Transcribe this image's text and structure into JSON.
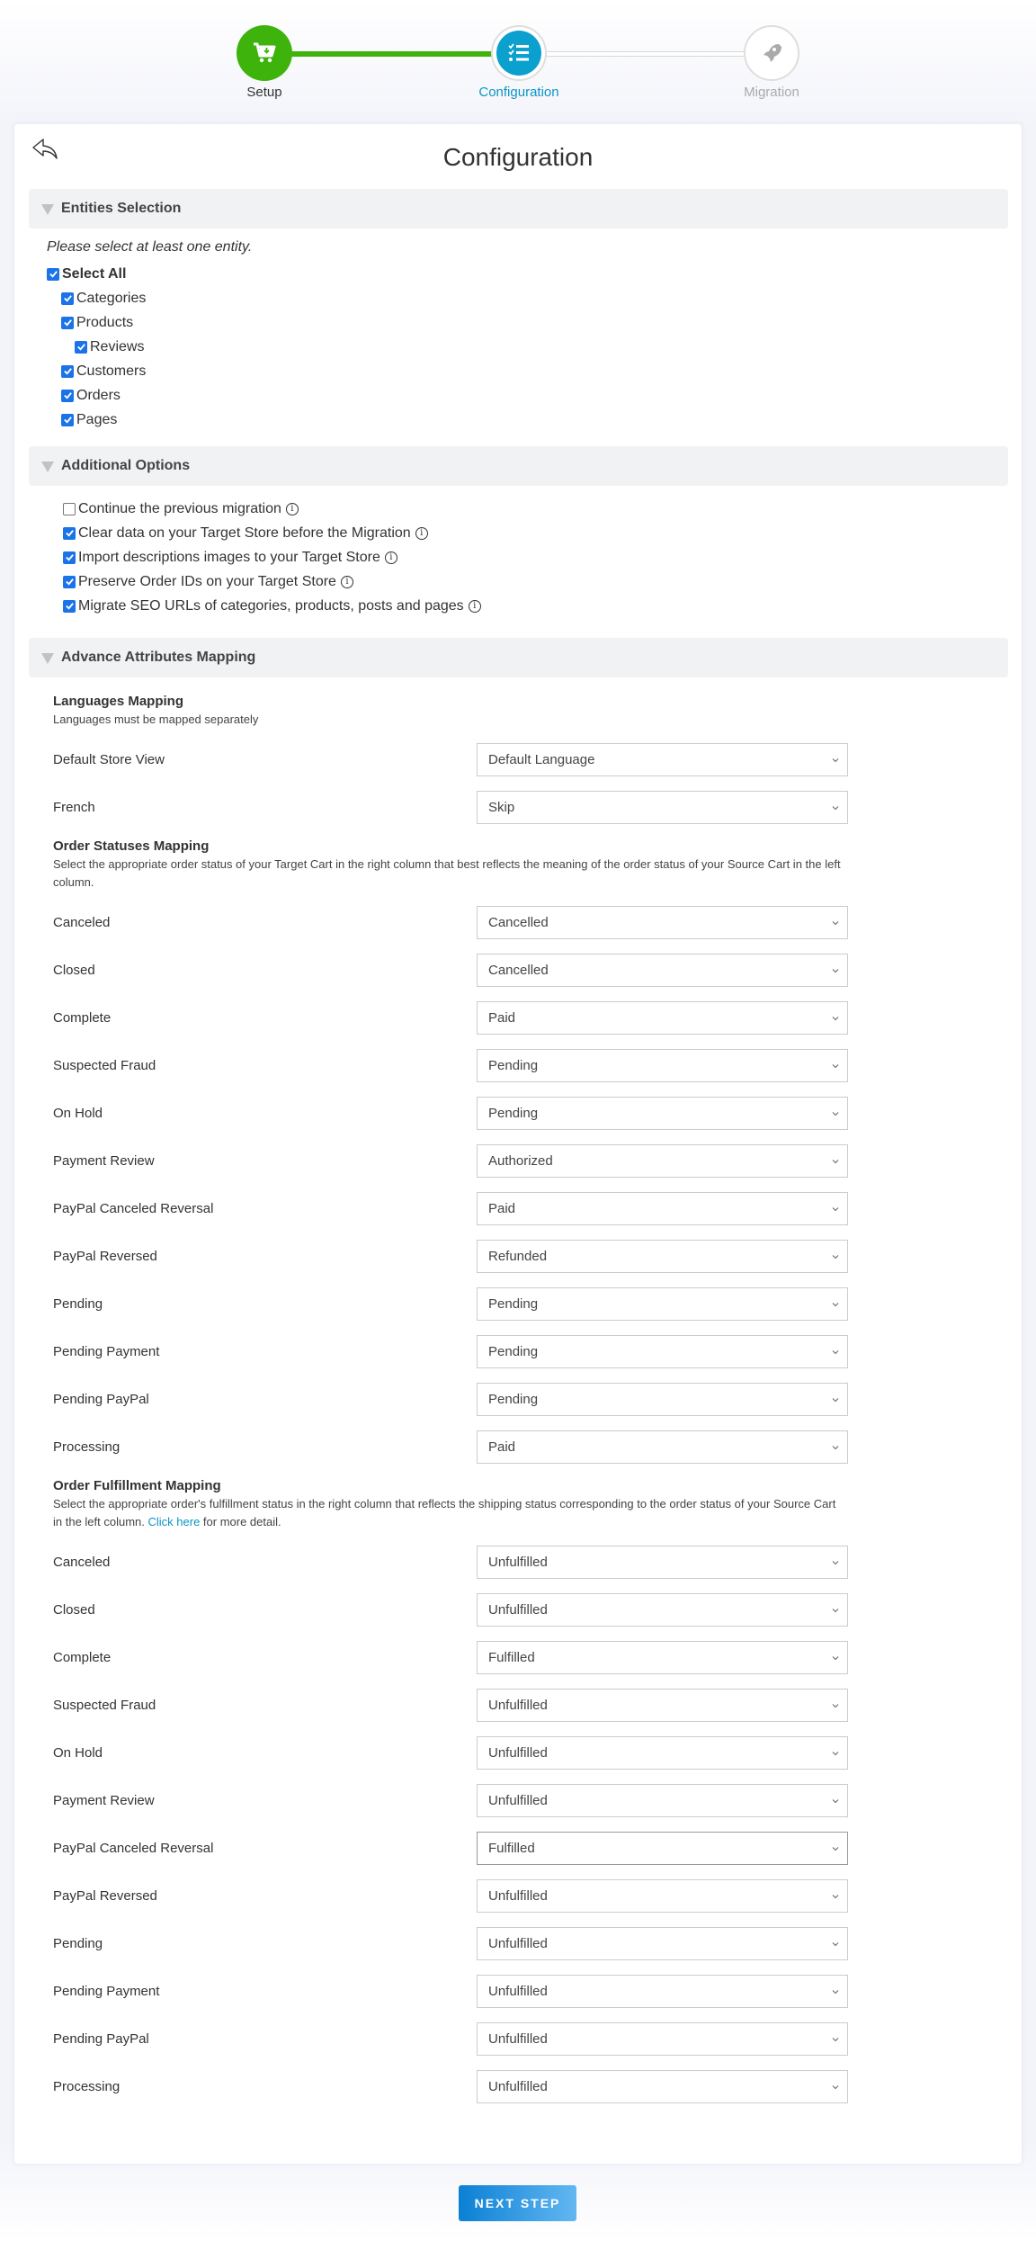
{
  "stepper": {
    "steps": [
      {
        "label": "Setup",
        "icon": "cart-download-icon",
        "state": "done"
      },
      {
        "label": "Configuration",
        "icon": "checklist-icon",
        "state": "active"
      },
      {
        "label": "Migration",
        "icon": "rocket-icon",
        "state": "pending"
      }
    ],
    "colors": {
      "done": "#3eb30b",
      "active": "#0ca0cf",
      "pending": "#aaaaaa"
    }
  },
  "card": {
    "title": "Configuration",
    "back_icon": "reply-arrow-icon"
  },
  "entities": {
    "header": "Entities Selection",
    "hint": "Please select at least one entity.",
    "select_all": {
      "label": "Select All",
      "checked": true
    },
    "items": [
      {
        "label": "Categories",
        "checked": true,
        "level": 1
      },
      {
        "label": "Products",
        "checked": true,
        "level": 1
      },
      {
        "label": "Reviews",
        "checked": true,
        "level": 2
      },
      {
        "label": "Customers",
        "checked": true,
        "level": 1
      },
      {
        "label": "Orders",
        "checked": true,
        "level": 1
      },
      {
        "label": "Pages",
        "checked": true,
        "level": 1
      }
    ]
  },
  "additional": {
    "header": "Additional Options",
    "options": [
      {
        "label": "Continue the previous migration",
        "checked": false
      },
      {
        "label": "Clear data on your Target Store before the Migration",
        "checked": true
      },
      {
        "label": "Import descriptions images to your Target Store",
        "checked": true
      },
      {
        "label": "Preserve Order IDs on your Target Store",
        "checked": true
      },
      {
        "label": "Migrate SEO URLs of categories, products, posts and pages",
        "checked": true
      }
    ],
    "info_glyph": "i"
  },
  "advance": {
    "header": "Advance Attributes Mapping",
    "languages": {
      "title": "Languages Mapping",
      "desc": "Languages must be mapped separately",
      "rows": [
        {
          "source": "Default Store View",
          "target": "Default Language"
        },
        {
          "source": "French",
          "target": "Skip"
        }
      ]
    },
    "order_statuses": {
      "title": "Order Statuses Mapping",
      "desc": "Select the appropriate order status of your Target Cart in the right column that best reflects the meaning of the order status of your Source Cart in the left column.",
      "rows": [
        {
          "source": "Canceled",
          "target": "Cancelled"
        },
        {
          "source": "Closed",
          "target": "Cancelled"
        },
        {
          "source": "Complete",
          "target": "Paid"
        },
        {
          "source": "Suspected Fraud",
          "target": "Pending"
        },
        {
          "source": "On Hold",
          "target": "Pending"
        },
        {
          "source": "Payment Review",
          "target": "Authorized"
        },
        {
          "source": "PayPal Canceled Reversal",
          "target": "Paid"
        },
        {
          "source": "PayPal Reversed",
          "target": "Refunded"
        },
        {
          "source": "Pending",
          "target": "Pending"
        },
        {
          "source": "Pending Payment",
          "target": "Pending"
        },
        {
          "source": "Pending PayPal",
          "target": "Pending"
        },
        {
          "source": "Processing",
          "target": "Paid"
        }
      ]
    },
    "fulfillment": {
      "title": "Order Fulfillment Mapping",
      "desc_before": "Select the appropriate order's fulfillment status in the right column that reflects the shipping status corresponding to the order status of your Source Cart in the left column. ",
      "link_text": "Click here",
      "desc_after": " for more detail.",
      "rows": [
        {
          "source": "Canceled",
          "target": "Unfulfilled"
        },
        {
          "source": "Closed",
          "target": "Unfulfilled"
        },
        {
          "source": "Complete",
          "target": "Fulfilled"
        },
        {
          "source": "Suspected Fraud",
          "target": "Unfulfilled"
        },
        {
          "source": "On Hold",
          "target": "Unfulfilled"
        },
        {
          "source": "Payment Review",
          "target": "Unfulfilled"
        },
        {
          "source": "PayPal Canceled Reversal",
          "target": "Fulfilled",
          "focused": true
        },
        {
          "source": "PayPal Reversed",
          "target": "Unfulfilled"
        },
        {
          "source": "Pending",
          "target": "Unfulfilled"
        },
        {
          "source": "Pending Payment",
          "target": "Unfulfilled"
        },
        {
          "source": "Pending PayPal",
          "target": "Unfulfilled"
        },
        {
          "source": "Processing",
          "target": "Unfulfilled"
        }
      ]
    }
  },
  "footer": {
    "next_label": "NEXT STEP"
  }
}
